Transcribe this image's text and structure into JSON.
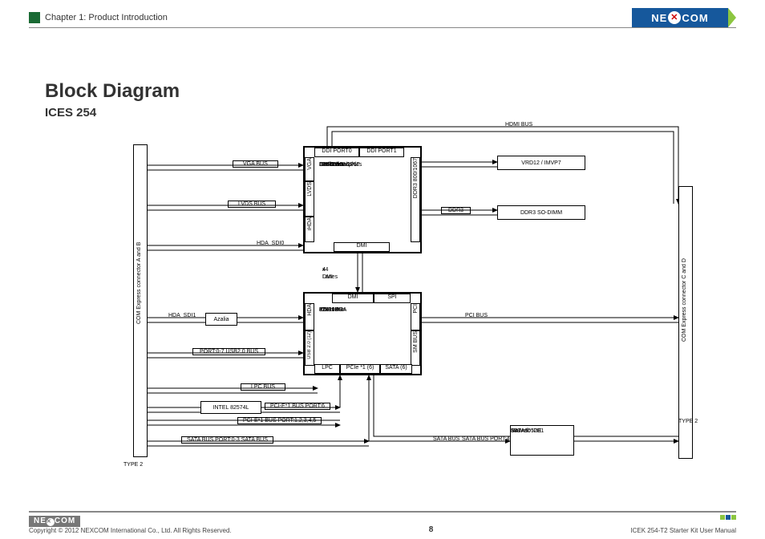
{
  "header": {
    "chapter": "Chapter 1: Product Introduction"
  },
  "logo": {
    "pre": "NE",
    "post": "COM"
  },
  "heading": {
    "h1": "Block Diagram",
    "h2": "ICES 254"
  },
  "connectors": {
    "left_label": "COM Express connector A and B",
    "left_type": "TYPE 2",
    "right_label": "COM Express connector C and D",
    "right_type": "TYPE 2"
  },
  "cpu": {
    "ddi0": "DDI PORT0",
    "ddi1": "DDI PORT1",
    "vga": "VGA",
    "lvds": "LVDS",
    "ihda": "iHDA",
    "ddr3": "DDR3 800/1067",
    "dmi": "DMI",
    "body": [
      "CedarView",
      "Dual Core CPU",
      "DX10.1 Graphics",
      "DDR3-800/1067",
      "559 balls",
      "22*22mm"
    ]
  },
  "pch": {
    "dmi": "DMI",
    "spi": "SPI",
    "hda": "HDA",
    "usb": "USB 2.0 (12)",
    "pci": "PCI",
    "smbus": "SM BUS",
    "lpc": "LPC",
    "pcie": "PCIe *1 (6)",
    "sata": "SATA (6)",
    "body": [
      "82801JIR",
      "PCH",
      "ICH10R",
      "676 mBGA",
      "31x31 mm"
    ],
    "dmi_link": [
      "x4 DMI",
      "4 Lanes"
    ]
  },
  "bus": {
    "hdmi": "HDMI   BUS",
    "vga": "VGA BUS",
    "lvds": "LVDS BUS",
    "hda_sdi0": "HDA_SDI0",
    "hda_sdi1": "HDA_SDI1",
    "azalia": "Azalia",
    "usb_port": "PORT:0-7      USB2.0 BUS",
    "lpc": "LPC BUS",
    "pcie6": "PCI-E*1 BUS PORT:6",
    "pcie_sub": "PCI-E*1 BUS PORT:1,2,3,4,5",
    "sata_left": "SATA BUS PORT:0-3    SATA BUS",
    "sata_right_a": "SATA BUS",
    "sata_right_b": "SATA BUS PORT:4",
    "pci": "PCI   BUS",
    "ddr3": "DDR3"
  },
  "chips": {
    "vrd": "VRD12 / IMVP7",
    "sodimm": "DDR3 SO-DIMM",
    "intel_lan": "INTEL 82574L",
    "sata_ide": [
      "SATA to IDE",
      "Marvell",
      "88SA8052B1"
    ]
  },
  "footer": {
    "copyright": "Copyright © 2012 NEXCOM International Co., Ltd. All Rights Reserved.",
    "page": "8",
    "doc": "ICEK 254-T2 Starter Kit User Manual"
  }
}
